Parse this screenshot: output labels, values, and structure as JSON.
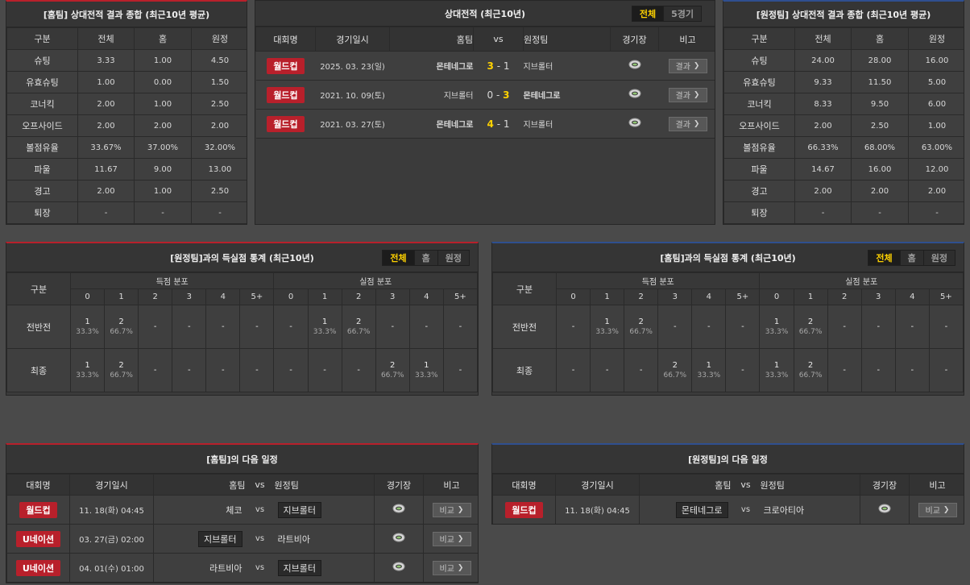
{
  "home_summary": {
    "title": "[홈팀] 상대전적 결과 종합 (최근10년 평균)",
    "headers": [
      "구분",
      "전체",
      "홈",
      "원정"
    ],
    "rows": [
      [
        "슈팅",
        "3.33",
        "1.00",
        "4.50"
      ],
      [
        "유효슈팅",
        "1.00",
        "0.00",
        "1.50"
      ],
      [
        "코너킥",
        "2.00",
        "1.00",
        "2.50"
      ],
      [
        "오프사이드",
        "2.00",
        "2.00",
        "2.00"
      ],
      [
        "볼점유율",
        "33.67%",
        "37.00%",
        "32.00%"
      ],
      [
        "파울",
        "11.67",
        "9.00",
        "13.00"
      ],
      [
        "경고",
        "2.00",
        "1.00",
        "2.50"
      ],
      [
        "퇴장",
        "-",
        "-",
        "-"
      ]
    ]
  },
  "head_to_head": {
    "title": "상대전적 (최근10년)",
    "tabs": [
      "전체",
      "5경기"
    ],
    "headers": {
      "league": "대회명",
      "date": "경기일시",
      "home": "홈팀",
      "vs": "vs",
      "away": "원정팀",
      "venue": "경기장",
      "note": "비고"
    },
    "matches": [
      {
        "league": "월드컵",
        "date": "2025. 03. 23(일)",
        "home": "몬테네그로",
        "home_score": "3",
        "sep": "-",
        "away_score": "1",
        "away": "지브롤터",
        "result": "결과"
      },
      {
        "league": "월드컵",
        "date": "2021. 10. 09(토)",
        "home": "지브롤터",
        "home_score": "0",
        "sep": "-",
        "away_score": "3",
        "away": "몬테네그로",
        "result": "결과"
      },
      {
        "league": "월드컵",
        "date": "2021. 03. 27(토)",
        "home": "몬테네그로",
        "home_score": "4",
        "sep": "-",
        "away_score": "1",
        "away": "지브롤터",
        "result": "결과"
      }
    ]
  },
  "away_summary": {
    "title": "[원정팀] 상대전적 결과 종합 (최근10년 평균)",
    "headers": [
      "구분",
      "전체",
      "홈",
      "원정"
    ],
    "rows": [
      [
        "슈팅",
        "24.00",
        "28.00",
        "16.00"
      ],
      [
        "유효슈팅",
        "9.33",
        "11.50",
        "5.00"
      ],
      [
        "코너킥",
        "8.33",
        "9.50",
        "6.00"
      ],
      [
        "오프사이드",
        "2.00",
        "2.50",
        "1.00"
      ],
      [
        "볼점유율",
        "66.33%",
        "68.00%",
        "63.00%"
      ],
      [
        "파울",
        "14.67",
        "16.00",
        "12.00"
      ],
      [
        "경고",
        "2.00",
        "2.00",
        "2.00"
      ],
      [
        "퇴장",
        "-",
        "-",
        "-"
      ]
    ]
  },
  "home_goals": {
    "title": "[원정팀]과의 득실점 통계 (최근10년)",
    "tabs": [
      "전체",
      "홈",
      "원정"
    ],
    "label_header": "구분",
    "scored_header": "득점 분포",
    "conceded_header": "실점 분포",
    "buckets": [
      "0",
      "1",
      "2",
      "3",
      "4",
      "5+"
    ],
    "rows": [
      {
        "label": "전반전",
        "scored": [
          {
            "n": "1",
            "p": "33.3%"
          },
          {
            "n": "2",
            "p": "66.7%"
          },
          {
            "n": "-",
            "p": ""
          },
          {
            "n": "-",
            "p": ""
          },
          {
            "n": "-",
            "p": ""
          },
          {
            "n": "-",
            "p": ""
          }
        ],
        "conceded": [
          {
            "n": "-",
            "p": ""
          },
          {
            "n": "1",
            "p": "33.3%"
          },
          {
            "n": "2",
            "p": "66.7%"
          },
          {
            "n": "-",
            "p": ""
          },
          {
            "n": "-",
            "p": ""
          },
          {
            "n": "-",
            "p": ""
          }
        ]
      },
      {
        "label": "최종",
        "scored": [
          {
            "n": "1",
            "p": "33.3%"
          },
          {
            "n": "2",
            "p": "66.7%"
          },
          {
            "n": "-",
            "p": ""
          },
          {
            "n": "-",
            "p": ""
          },
          {
            "n": "-",
            "p": ""
          },
          {
            "n": "-",
            "p": ""
          }
        ],
        "conceded": [
          {
            "n": "-",
            "p": ""
          },
          {
            "n": "-",
            "p": ""
          },
          {
            "n": "-",
            "p": ""
          },
          {
            "n": "2",
            "p": "66.7%"
          },
          {
            "n": "1",
            "p": "33.3%"
          },
          {
            "n": "-",
            "p": ""
          }
        ]
      }
    ]
  },
  "away_goals": {
    "title": "[홈팀]과의 득실점 통계 (최근10년)",
    "tabs": [
      "전체",
      "홈",
      "원정"
    ],
    "label_header": "구분",
    "scored_header": "득점 분포",
    "conceded_header": "실점 분포",
    "buckets": [
      "0",
      "1",
      "2",
      "3",
      "4",
      "5+"
    ],
    "rows": [
      {
        "label": "전반전",
        "scored": [
          {
            "n": "-",
            "p": ""
          },
          {
            "n": "1",
            "p": "33.3%"
          },
          {
            "n": "2",
            "p": "66.7%"
          },
          {
            "n": "-",
            "p": ""
          },
          {
            "n": "-",
            "p": ""
          },
          {
            "n": "-",
            "p": ""
          }
        ],
        "conceded": [
          {
            "n": "1",
            "p": "33.3%"
          },
          {
            "n": "2",
            "p": "66.7%"
          },
          {
            "n": "-",
            "p": ""
          },
          {
            "n": "-",
            "p": ""
          },
          {
            "n": "-",
            "p": ""
          },
          {
            "n": "-",
            "p": ""
          }
        ]
      },
      {
        "label": "최종",
        "scored": [
          {
            "n": "-",
            "p": ""
          },
          {
            "n": "-",
            "p": ""
          },
          {
            "n": "-",
            "p": ""
          },
          {
            "n": "2",
            "p": "66.7%"
          },
          {
            "n": "1",
            "p": "33.3%"
          },
          {
            "n": "-",
            "p": ""
          }
        ],
        "conceded": [
          {
            "n": "1",
            "p": "33.3%"
          },
          {
            "n": "2",
            "p": "66.7%"
          },
          {
            "n": "-",
            "p": ""
          },
          {
            "n": "-",
            "p": ""
          },
          {
            "n": "-",
            "p": ""
          },
          {
            "n": "-",
            "p": ""
          }
        ]
      }
    ]
  },
  "home_next": {
    "title": "[홈팀]의 다음 일정",
    "headers": {
      "league": "대회명",
      "date": "경기일시",
      "home": "홈팀",
      "vs": "vs",
      "away": "원정팀",
      "venue": "경기장",
      "note": "비고"
    },
    "rows": [
      {
        "league": "월드컵",
        "date": "11. 18(화) 04:45",
        "home": "체코",
        "home_boxed": false,
        "vs": "vs",
        "away": "지브롤터",
        "away_boxed": true,
        "compare": "비교"
      },
      {
        "league": "U네이션",
        "date": "03. 27(금) 02:00",
        "home": "지브롤터",
        "home_boxed": true,
        "vs": "vs",
        "away": "라트비아",
        "away_boxed": false,
        "compare": "비교"
      },
      {
        "league": "U네이션",
        "date": "04. 01(수) 01:00",
        "home": "라트비아",
        "home_boxed": false,
        "vs": "vs",
        "away": "지브롤터",
        "away_boxed": true,
        "compare": "비교"
      }
    ]
  },
  "away_next": {
    "title": "[원정팀]의 다음 일정",
    "headers": {
      "league": "대회명",
      "date": "경기일시",
      "home": "홈팀",
      "vs": "vs",
      "away": "원정팀",
      "venue": "경기장",
      "note": "비고"
    },
    "rows": [
      {
        "league": "월드컵",
        "date": "11. 18(화) 04:45",
        "home": "몬테네그로",
        "home_boxed": true,
        "vs": "vs",
        "away": "크로아티아",
        "away_boxed": false,
        "compare": "비교"
      }
    ]
  },
  "colors": {
    "accent_red": "#b8202b",
    "accent_blue": "#2f4f8f",
    "winner": "#ffd200"
  },
  "icons": {
    "venue": "stadium-icon",
    "chevron": "chevron-right-icon"
  }
}
